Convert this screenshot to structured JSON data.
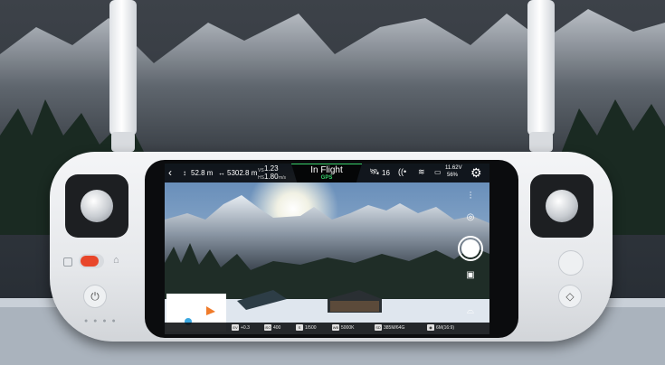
{
  "status_bar": {
    "back_label": "‹",
    "height_value": "52.8 m",
    "distance_value": "5302.8 m",
    "vs_label": "VS",
    "vs_value": "1.23",
    "hs_label": "HS",
    "hs_value": "1.80",
    "speed_unit": "m/s",
    "mode_label": "In Flight",
    "gps_label": "GPS",
    "satellite_count": "16",
    "battery_voltage": "11.62V",
    "battery_percent": "56%"
  },
  "bottom_bar": {
    "ev_value": "+0.3",
    "iso_value": "400",
    "shutter_value": "1/500",
    "wb_value": "5000K",
    "storage_value": "385M/64G",
    "resolution_value": "6M(16:9)"
  },
  "colors": {
    "gps_accent": "#37d06a",
    "record_button": "#e8462a",
    "map_arrow": "#f07b2a",
    "map_marker": "#3aa7e0"
  },
  "icons": {
    "back": "back-arrow-icon",
    "height": "height-arrow-icon",
    "distance": "distance-arrow-icon",
    "satellite": "satellite-icon",
    "signal": "signal-icon",
    "wifi": "wifi-icon",
    "battery": "battery-icon",
    "settings": "gear-icon",
    "adjust": "sliders-icon",
    "camera_switch": "camera-switch-icon",
    "gallery": "gallery-icon",
    "gimbal": "gimbal-icon",
    "power": "power-icon",
    "home": "home-icon"
  }
}
